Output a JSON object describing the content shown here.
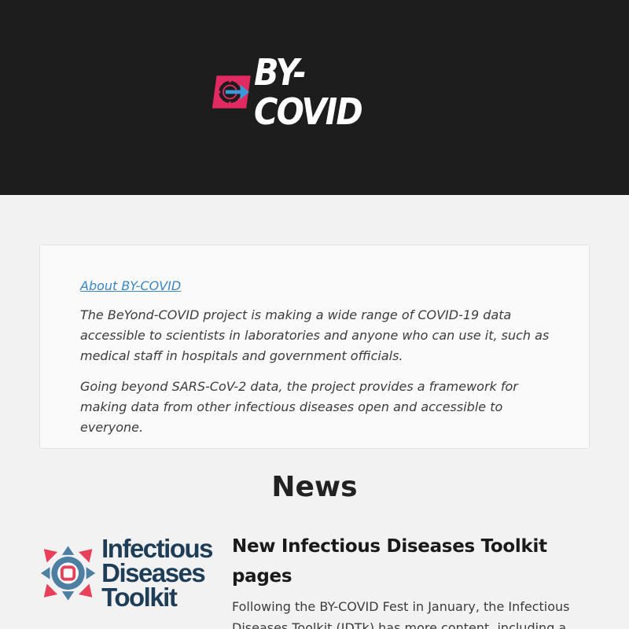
{
  "header": {
    "logo_text": "BY-COVID",
    "colors": {
      "background": "#1d1d1d",
      "brand_pink": "#e12a5f",
      "brand_blue": "#3a9ad9"
    }
  },
  "about": {
    "link_label": "About BY-COVID",
    "paragraphs": [
      "The BeYond-COVID project is making a wide range of COVID-19 data accessible to scientists in laboratories and anyone who can use it, such as medical staff in hospitals and government officials.",
      "Going beyond SARS-CoV-2 data, the project provides a framework for making data from other infectious diseases open and accessible to everyone."
    ]
  },
  "news": {
    "heading": "News",
    "items": [
      {
        "logo_lines": [
          "Infectious",
          "Diseases",
          "Toolkit"
        ],
        "title": "New Infectious Diseases Toolkit pages",
        "text": "Following the BY-COVID Fest in January, the Infectious Diseases Toolkit (IDTk) has more content, including a showcase page on prototyping federated causal"
      }
    ]
  }
}
